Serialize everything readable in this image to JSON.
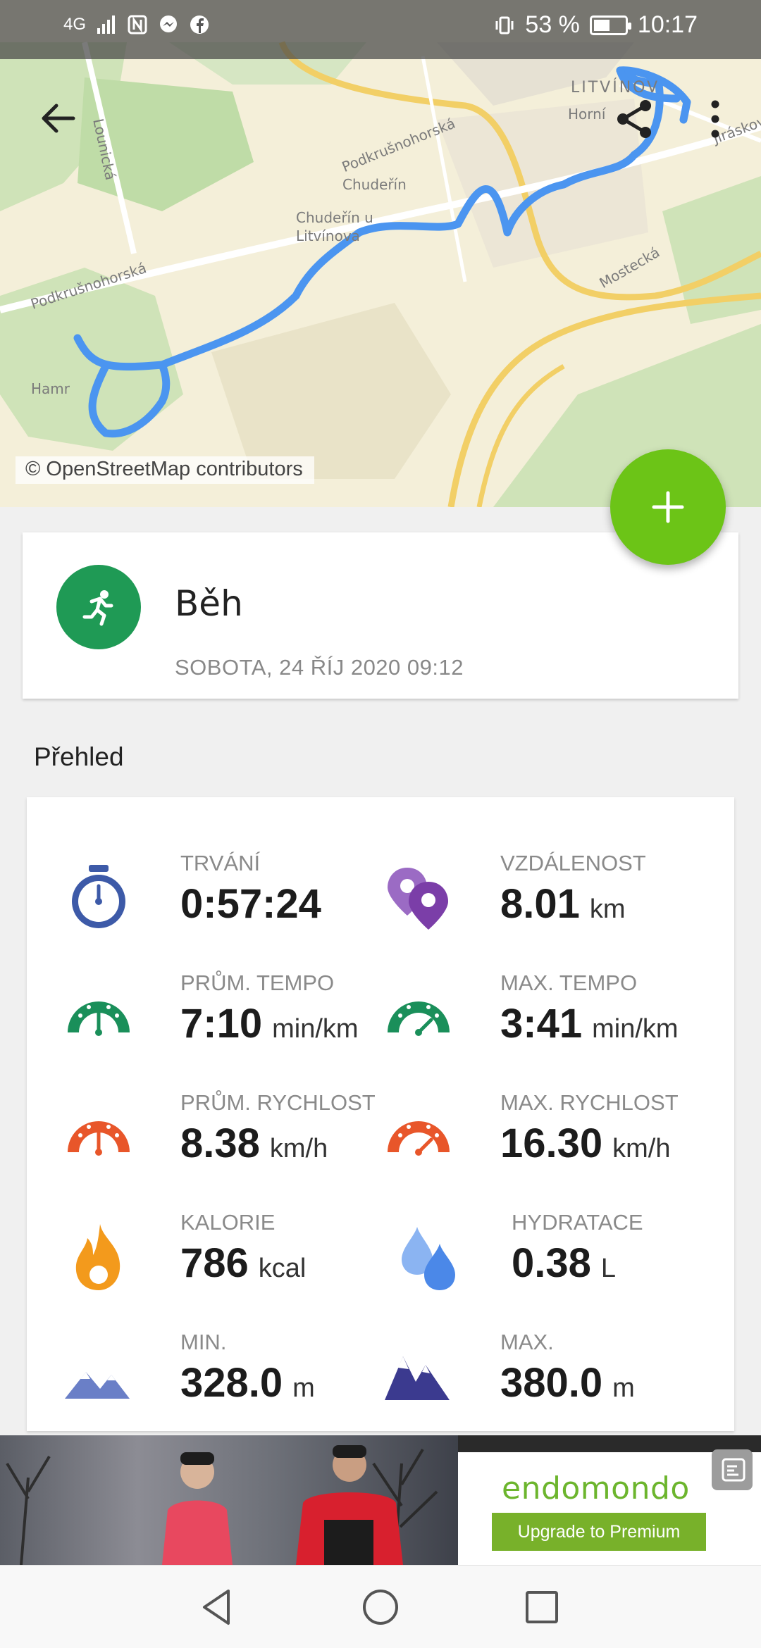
{
  "status_bar": {
    "network": "4G",
    "battery_percent": "53 %",
    "battery_level": 0.53,
    "time": "10:17",
    "icons": [
      "signal-icon",
      "nfc-icon",
      "messenger-icon",
      "facebook-icon",
      "vibrate-icon",
      "battery-icon"
    ]
  },
  "map": {
    "attribution": "© OpenStreetMap contributors",
    "labels": [
      "LITVÍNOV",
      "Horní",
      "Podkrušnohorská",
      "Chudeřín",
      "Chudeřín u Litvínova",
      "Lounická",
      "Podkrušnohorská",
      "Hamr",
      "Mostecká",
      "Jiráskova"
    ],
    "route_color": "#4b95f0"
  },
  "toolbar": {
    "back_icon": "arrow-left-icon",
    "share_icon": "share-icon",
    "more_icon": "more-vert-icon"
  },
  "fab": {
    "icon": "plus-icon",
    "color": "#6cc417"
  },
  "activity": {
    "sport": "Běh",
    "date": "SOBOTA, 24 ŘÍJ 2020 09:12",
    "icon": "running-icon",
    "icon_color": "#1f9a55"
  },
  "overview": {
    "title": "Přehled",
    "stats": [
      {
        "label": "TRVÁNÍ",
        "value": "0:57:24",
        "unit": "",
        "icon": "stopwatch-icon",
        "color": "#3d5aa8"
      },
      {
        "label": "VZDÁLENOST",
        "value": "8.01",
        "unit": "km",
        "icon": "location-pins-icon",
        "color": "#7b3ea8"
      },
      {
        "label": "PRŮM. TEMPO",
        "value": "7:10",
        "unit": "min/km",
        "icon": "gauge-icon",
        "color": "#1a8f5a"
      },
      {
        "label": "MAX. TEMPO",
        "value": "3:41",
        "unit": "min/km",
        "icon": "gauge-icon",
        "color": "#1a8f5a"
      },
      {
        "label": "PRŮM. RYCHLOST",
        "value": "8.38",
        "unit": "km/h",
        "icon": "gauge-icon",
        "color": "#e8562a"
      },
      {
        "label": "MAX. RYCHLOST",
        "value": "16.30",
        "unit": "km/h",
        "icon": "gauge-icon",
        "color": "#e8562a"
      },
      {
        "label": "KALORIE",
        "value": "786",
        "unit": "kcal",
        "icon": "fire-icon",
        "color": "#f39a1c"
      },
      {
        "label": "HYDRATACE",
        "value": "0.38",
        "unit": "L",
        "icon": "water-drops-icon",
        "color": "#4b88e8"
      },
      {
        "label": "MIN.",
        "value": "328.0",
        "unit": "m",
        "icon": "mountains-icon",
        "color": "#6a7fc7"
      },
      {
        "label": "MAX.",
        "value": "380.0",
        "unit": "m",
        "icon": "mountains-icon",
        "color": "#3b3a8f"
      }
    ]
  },
  "ad": {
    "brand": "endomondo",
    "cta": "Upgrade to Premium",
    "close_icon": "ad-close-icon"
  },
  "nav_bar": {
    "icons": [
      "back-triangle-icon",
      "home-circle-icon",
      "recents-square-icon"
    ]
  }
}
